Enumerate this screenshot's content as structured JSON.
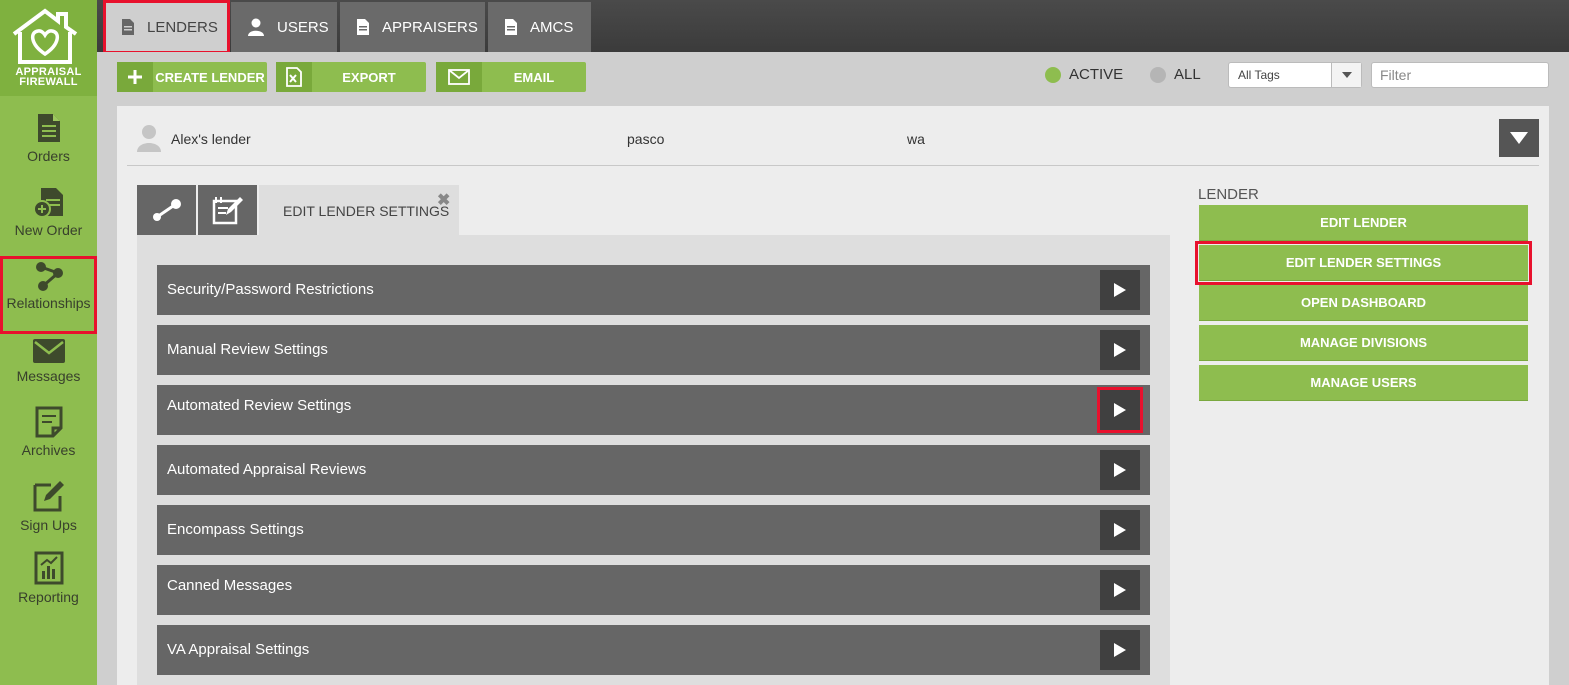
{
  "brand": {
    "line1": "APPRAISAL",
    "line2": "FIREWALL"
  },
  "colors": {
    "accent_green": "#8ebd4f",
    "dark_gray": "#666666",
    "highlight_red": "#e8112d"
  },
  "sidebar": {
    "items": [
      {
        "label": "Orders",
        "icon": "document-icon"
      },
      {
        "label": "New Order",
        "icon": "new-order-icon"
      },
      {
        "label": "Relationships",
        "icon": "relationships-icon"
      },
      {
        "label": "Messages",
        "icon": "envelope-icon"
      },
      {
        "label": "Archives",
        "icon": "archive-icon"
      },
      {
        "label": "Sign Ups",
        "icon": "edit-icon"
      },
      {
        "label": "Reporting",
        "icon": "chart-icon"
      }
    ]
  },
  "top_tabs": [
    {
      "label": "LENDERS",
      "icon": "document-icon"
    },
    {
      "label": "USERS",
      "icon": "user-icon"
    },
    {
      "label": "APPRAISERS",
      "icon": "document-icon"
    },
    {
      "label": "AMCS",
      "icon": "document-icon"
    }
  ],
  "actions": {
    "create": "CREATE LENDER",
    "export": "EXPORT",
    "email": "EMAIL"
  },
  "filters": {
    "active_label": "ACTIVE",
    "all_label": "ALL",
    "tags_value": "All Tags",
    "filter_placeholder": "Filter"
  },
  "lender_row": {
    "name": "Alex's lender",
    "city": "pasco",
    "state": "wa"
  },
  "panel_tabs": {
    "edit_settings": "EDIT LENDER SETTINGS"
  },
  "settings": [
    "Security/Password Restrictions",
    "Manual Review Settings",
    "Automated Review Settings",
    "Automated Appraisal Reviews",
    "Encompass Settings",
    "Canned Messages",
    "VA Appraisal Settings"
  ],
  "lender_menu": {
    "heading": "LENDER",
    "buttons": [
      "EDIT LENDER",
      "EDIT LENDER SETTINGS",
      "OPEN DASHBOARD",
      "MANAGE DIVISIONS",
      "MANAGE USERS"
    ]
  }
}
